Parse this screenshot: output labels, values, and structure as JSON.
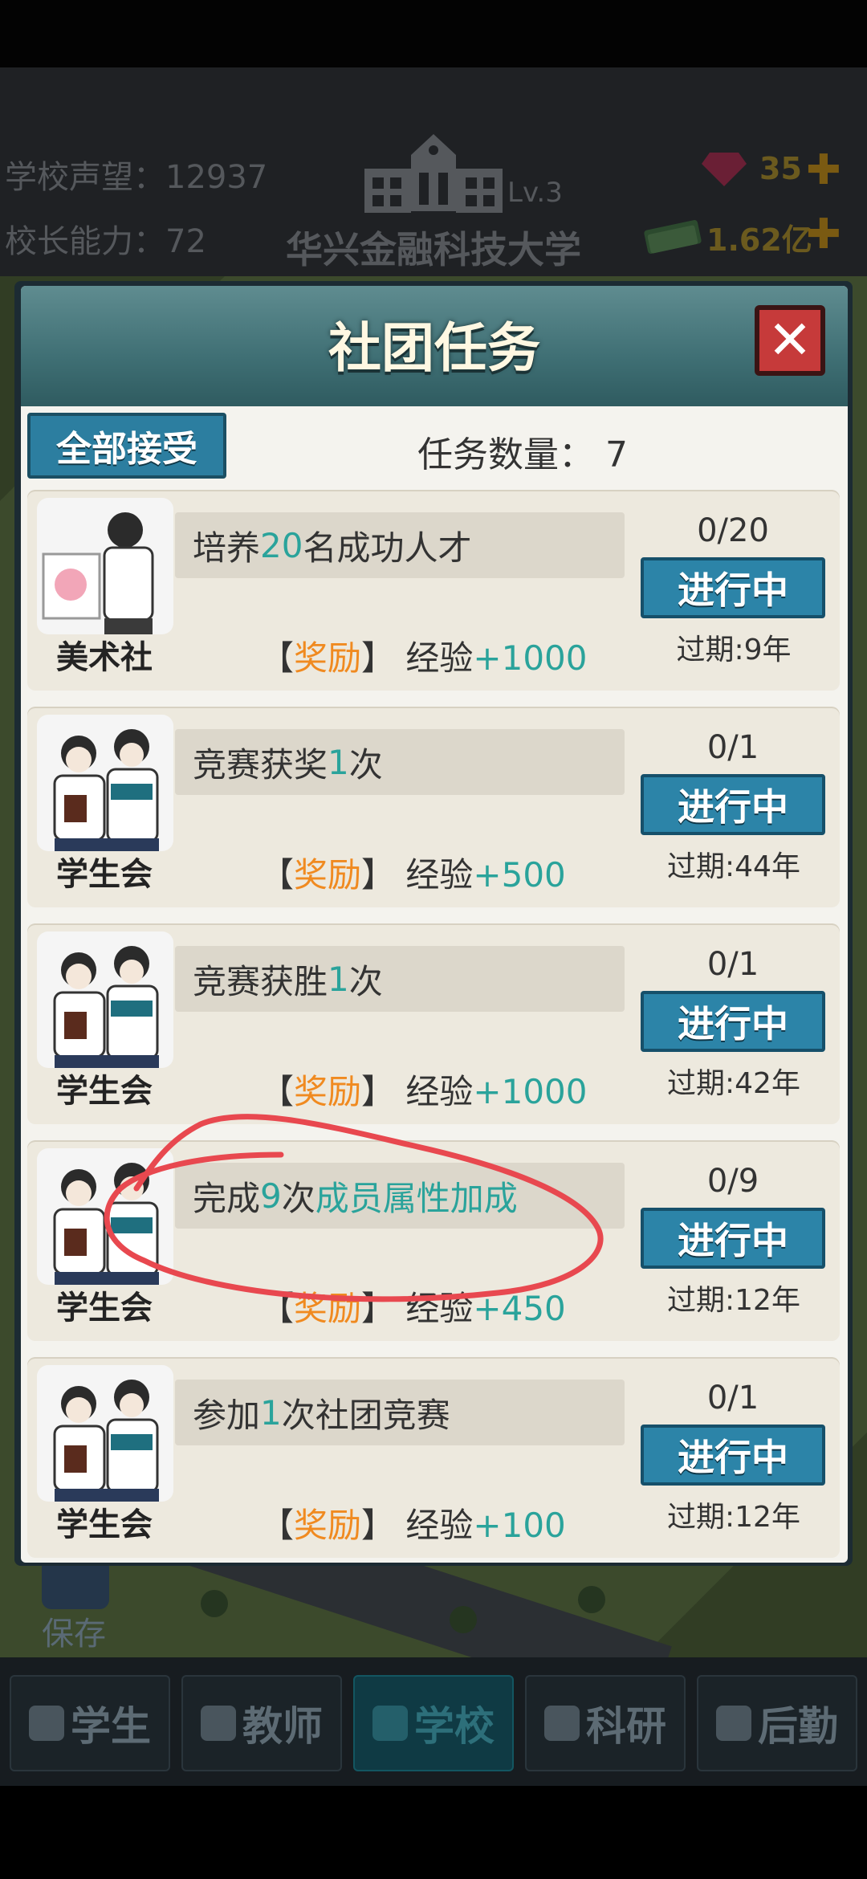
{
  "header": {
    "reputation_label": "学校声望：12937",
    "ability_label": "校长能力：72",
    "level": "Lv.3",
    "school_name": "华兴金融科技大学",
    "gems": "35",
    "money": "1.62亿"
  },
  "save": {
    "label": "保存"
  },
  "modal": {
    "title": "社团任务",
    "accept_all": "全部接受",
    "task_count": "任务数量：  7"
  },
  "tasks": [
    {
      "club": "美术社",
      "desc_prefix": "培养",
      "desc_num": "20",
      "desc_suffix": "名成功人才",
      "desc_hl2": "",
      "reward_open": "【",
      "reward_word": "奖励",
      "reward_close": "】",
      "reward_type": "经验",
      "reward_value": "+1000",
      "progress": "0/20",
      "status": "进行中",
      "expiry": "过期:9年"
    },
    {
      "club": "学生会",
      "desc_prefix": "竞赛获奖",
      "desc_num": "1",
      "desc_suffix": "次",
      "desc_hl2": "",
      "reward_open": "【",
      "reward_word": "奖励",
      "reward_close": "】",
      "reward_type": "经验",
      "reward_value": "+500",
      "progress": "0/1",
      "status": "进行中",
      "expiry": "过期:44年"
    },
    {
      "club": "学生会",
      "desc_prefix": "竞赛获胜",
      "desc_num": "1",
      "desc_suffix": "次",
      "desc_hl2": "",
      "reward_open": "【",
      "reward_word": "奖励",
      "reward_close": "】",
      "reward_type": "经验",
      "reward_value": "+1000",
      "progress": "0/1",
      "status": "进行中",
      "expiry": "过期:42年"
    },
    {
      "club": "学生会",
      "desc_prefix": "完成",
      "desc_num": "9",
      "desc_suffix": "次",
      "desc_hl2": "成员属性加成",
      "reward_open": "【",
      "reward_word": "奖励",
      "reward_close": "】",
      "reward_type": "经验",
      "reward_value": "+450",
      "progress": "0/9",
      "status": "进行中",
      "expiry": "过期:12年"
    },
    {
      "club": "学生会",
      "desc_prefix": "参加",
      "desc_num": "1",
      "desc_suffix": "次社团竞赛",
      "desc_hl2": "",
      "reward_open": "【",
      "reward_word": "奖励",
      "reward_close": "】",
      "reward_type": "经验",
      "reward_value": "+100",
      "progress": "0/1",
      "status": "进行中",
      "expiry": "过期:12年"
    }
  ],
  "nav": {
    "tabs": [
      "学生",
      "教师",
      "学校",
      "科研",
      "后勤"
    ],
    "active": "学校"
  },
  "colors": {
    "accent_teal": "#2aa39b",
    "reward_orange": "#f08a20",
    "button_blue": "#2c84a8",
    "annotation_red": "#e8484f"
  },
  "icons": [
    "art-club-icon",
    "student-council-icon",
    "close-icon",
    "gem-icon",
    "money-icon",
    "plus-icon",
    "save-icon",
    "school-building-icon"
  ]
}
